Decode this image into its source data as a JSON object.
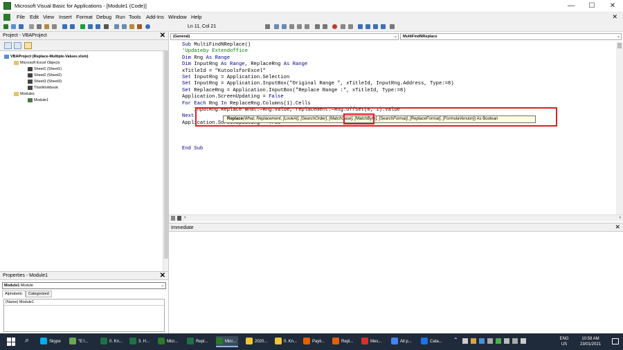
{
  "window": {
    "title": "Microsoft Visual Basic for Applications - [Module1 (Code)]",
    "minimize": "—",
    "maximize": "☐",
    "close": "✕"
  },
  "menu": {
    "items": [
      "File",
      "Edit",
      "View",
      "Insert",
      "Format",
      "Debug",
      "Run",
      "Tools",
      "Add-Ins",
      "Window",
      "Help"
    ],
    "doc_close": "✕"
  },
  "toolbar": {
    "position": "Ln 11, Col 21"
  },
  "project": {
    "title": "Project - VBAProject",
    "close": "✕",
    "tree": [
      {
        "label": "VBAProject (Replace-Multiple-Values.xlsm)",
        "bold": true
      },
      {
        "label": "Microsoft Excel Objects"
      },
      {
        "label": "Sheet1 (Sheet1)"
      },
      {
        "label": "Sheet2 (Sheet2)"
      },
      {
        "label": "Sheet3 (Sheet3)"
      },
      {
        "label": "ThisWorkbook"
      },
      {
        "label": "Modules"
      },
      {
        "label": "Module1"
      }
    ]
  },
  "properties": {
    "title": "Properties - Module1",
    "close": "✕",
    "object_name": "Module1",
    "object_type": "Module",
    "tabs": [
      "Alphabetic",
      "Categorized"
    ],
    "rows": [
      {
        "name": "(Name)",
        "value": "Module1"
      }
    ]
  },
  "code_window": {
    "object_combo": "(General)",
    "proc_combo": "MultiFindNReplace",
    "lines": [
      [
        {
          "t": "Sub ",
          "c": "kw"
        },
        {
          "t": "MultiFindNReplace()"
        }
      ],
      [
        {
          "t": "'Updateby Extendoffice",
          "c": "cm"
        }
      ],
      [
        {
          "t": "Dim ",
          "c": "kw"
        },
        {
          "t": "Rng "
        },
        {
          "t": "As Range",
          "c": "kw"
        }
      ],
      [
        {
          "t": "Dim ",
          "c": "kw"
        },
        {
          "t": "InputRng "
        },
        {
          "t": "As Range",
          "c": "kw"
        },
        {
          "t": ", ReplaceRng "
        },
        {
          "t": "As Range",
          "c": "kw"
        }
      ],
      [
        {
          "t": "xTitleId = \"KutoolsforExcel\""
        }
      ],
      [
        {
          "t": "Set ",
          "c": "kw"
        },
        {
          "t": "InputRng = Application.Selection"
        }
      ],
      [
        {
          "t": "Set ",
          "c": "kw"
        },
        {
          "t": "InputRng = Application.InputBox(\"Original Range \", xTitleId, InputRng.Address, Type:=8)"
        }
      ],
      [
        {
          "t": "Set ",
          "c": "kw"
        },
        {
          "t": "ReplaceRng = Application.InputBox(\"Replace Range :\", xTitleId, Type:=8)"
        }
      ],
      [
        {
          "t": "Application.ScreenUpdating = "
        },
        {
          "t": "False",
          "c": "kw"
        }
      ],
      [
        {
          "t": "For Each ",
          "c": "kw"
        },
        {
          "t": "Rng "
        },
        {
          "t": "In ",
          "c": "kw"
        },
        {
          "t": "ReplaceRng.Columns(1).Cells"
        }
      ],
      [
        {
          "t": "    InputRng.Replace what:=Rng.Value, replacement:=Rng.Offset(0, 1).Value"
        }
      ],
      [
        {
          "t": "Next",
          "c": "kw"
        }
      ],
      [
        {
          "t": "Application.ScreenUpdating = True"
        }
      ],
      [
        {
          "t": ""
        }
      ],
      [
        {
          "t": ""
        }
      ],
      [
        {
          "t": ""
        }
      ],
      [
        {
          "t": "End Sub",
          "c": "kw"
        }
      ]
    ]
  },
  "tooltip": {
    "method": "Replace",
    "open": "(",
    "args_before": "What, Replacement, [LookAt], [SearchOrder], ",
    "highlight": "[MatchCase]",
    "args_after": ", [MatchByte], [SearchFormat], [ReplaceFormat], [FormulaVersion]",
    "close_paren": ")",
    "returns": " As Boolean"
  },
  "immediate": {
    "title": "Immediate"
  },
  "taskbar": {
    "items": [
      {
        "label": "Skype",
        "color": "#00aff0"
      },
      {
        "label": "\"E:\\...",
        "color": "#6aa84f"
      },
      {
        "label": "0. Kn...",
        "color": "#1e7145"
      },
      {
        "label": "3. H...",
        "color": "#1e7145"
      },
      {
        "label": "Micr...",
        "color": "#2a7a2a"
      },
      {
        "label": "Repl...",
        "color": "#1e7145"
      },
      {
        "label": "Micr...",
        "color": "#2a7a2a",
        "active": true
      },
      {
        "label": "2020...",
        "color": "#f4c430"
      },
      {
        "label": "0. Kn...",
        "color": "#f4c430"
      },
      {
        "label": "Payli...",
        "color": "#e66000"
      },
      {
        "label": "Repl...",
        "color": "#e66000"
      },
      {
        "label": "Mes...",
        "color": "#d93025"
      },
      {
        "label": "All p...",
        "color": "#4285f4"
      },
      {
        "label": "Cata...",
        "color": "#1a73e8"
      }
    ],
    "lang": "ENG",
    "region": "US",
    "time": "10:58 AM",
    "date": "23/01/2021"
  }
}
